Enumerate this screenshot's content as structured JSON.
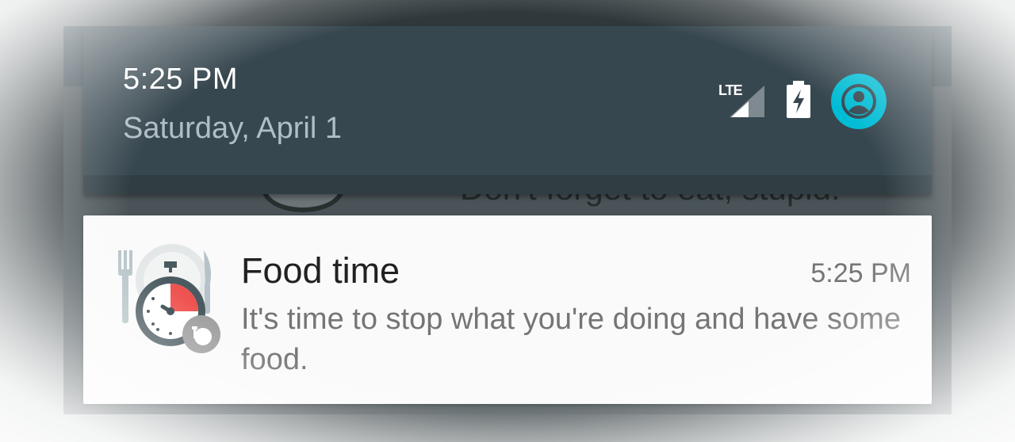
{
  "quick_settings": {
    "time": "5:25 PM",
    "date": "Saturday, April 1",
    "network_label": "LTE",
    "icons": [
      "lte-signal-icon",
      "battery-charging-icon",
      "user-avatar-icon"
    ]
  },
  "background_notification": {
    "text": "Don't forget to eat, stupid!"
  },
  "notification": {
    "title": "Food time",
    "time": "5:25 PM",
    "body": "It's time to stop what you're doing and have some food.",
    "icon": "food-timer-icon",
    "badge_icon": "app-badge-icon"
  },
  "colors": {
    "header_bg": "#37474f",
    "accent": "#00bcd4",
    "card_bg": "#fafafa",
    "timer_red": "#ef5350"
  }
}
